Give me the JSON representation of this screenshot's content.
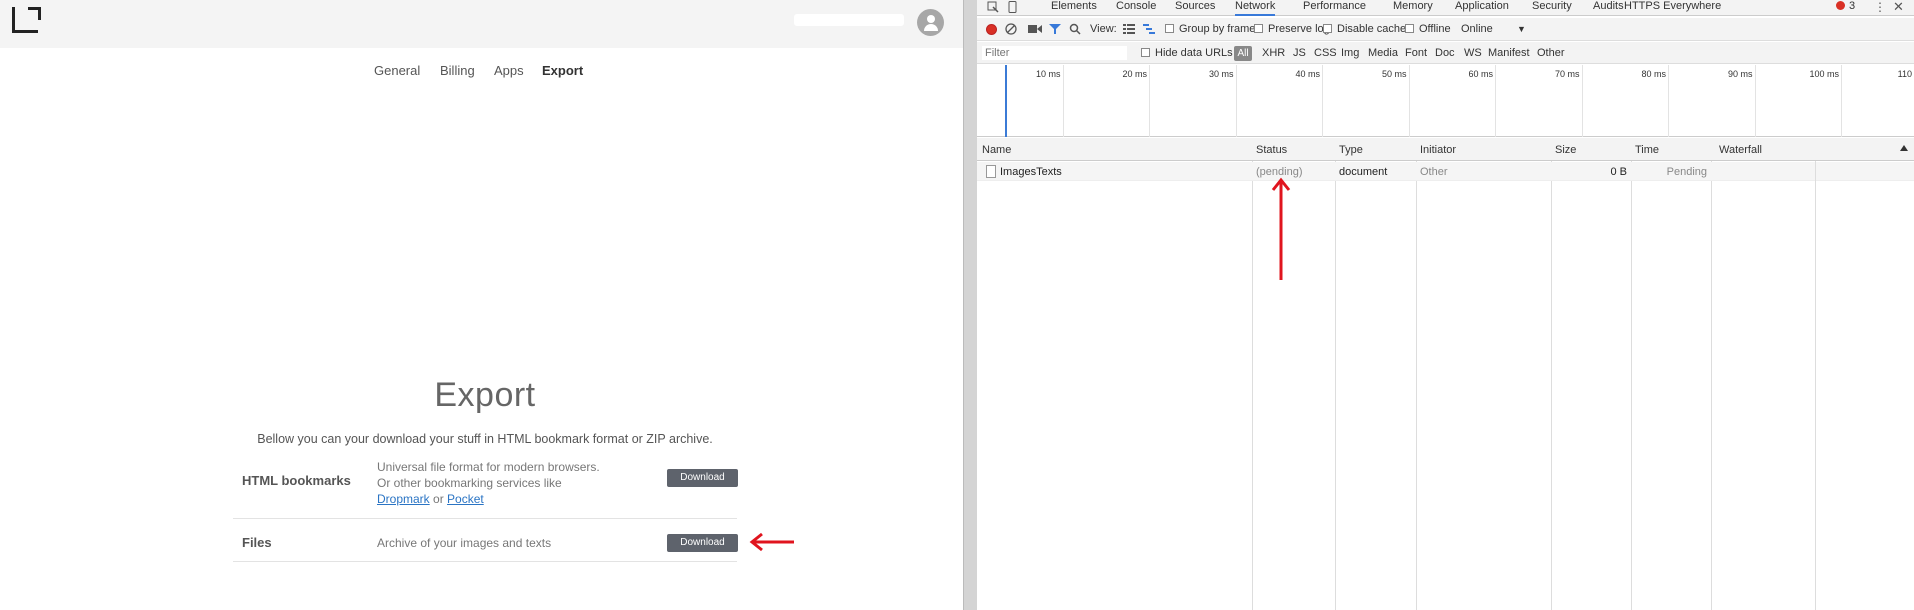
{
  "app": {
    "nav": [
      {
        "label": "General"
      },
      {
        "label": "Billing"
      },
      {
        "label": "Apps"
      },
      {
        "label": "Export",
        "active": true
      }
    ],
    "export": {
      "title": "Export",
      "description": "Bellow you can your download your stuff in HTML bookmark format or ZIP archive.",
      "rows": [
        {
          "label": "HTML bookmarks",
          "desc_line1": "Universal file format for modern browsers.",
          "desc_line2": "Or other bookmarking services like",
          "link1": "Dropmark",
          "or_text": "or",
          "link2": "Pocket",
          "button": "Download"
        },
        {
          "label": "Files",
          "desc_line1": "Archive of your images and texts",
          "button": "Download"
        }
      ]
    }
  },
  "devtools": {
    "tabs": [
      "Elements",
      "Console",
      "Sources",
      "Network",
      "Performance",
      "Memory",
      "Application",
      "Security",
      "Audits",
      "HTTPS Everywhere"
    ],
    "active_tab": "Network",
    "error_count": "3",
    "toolbar": {
      "view_label": "View:",
      "group_by_frame": "Group by frame",
      "preserve_log": "Preserve log",
      "disable_cache": "Disable cache",
      "offline": "Offline",
      "throttle": "Online"
    },
    "filterbar": {
      "placeholder": "Filter",
      "hide_data_urls": "Hide data URLs",
      "types": [
        "All",
        "XHR",
        "JS",
        "CSS",
        "Img",
        "Media",
        "Font",
        "Doc",
        "WS",
        "Manifest",
        "Other"
      ]
    },
    "timeline_ticks": [
      "10 ms",
      "20 ms",
      "30 ms",
      "40 ms",
      "50 ms",
      "60 ms",
      "70 ms",
      "80 ms",
      "90 ms",
      "100 ms",
      "110"
    ],
    "columns": [
      "Name",
      "Status",
      "Type",
      "Initiator",
      "Size",
      "Time",
      "Waterfall"
    ],
    "request": {
      "name": "ImagesTexts",
      "status": "(pending)",
      "type": "document",
      "initiator": "Other",
      "size": "0 B",
      "time": "Pending"
    }
  },
  "colors": {
    "accent_red": "#e0141e",
    "button_bg": "#5e636c",
    "link": "#2a74c4",
    "devtools_active_tab": "#3879d9"
  }
}
